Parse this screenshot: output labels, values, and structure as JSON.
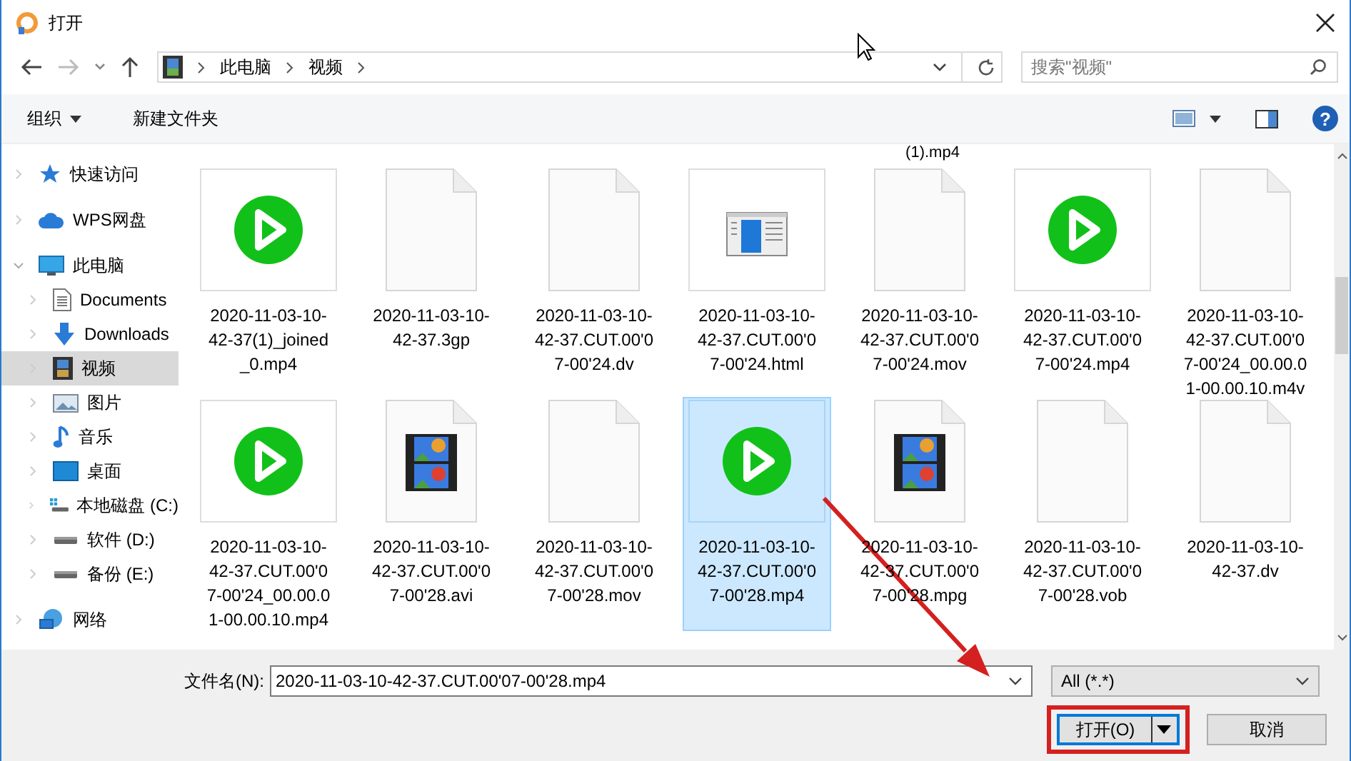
{
  "window": {
    "title": "打开"
  },
  "address_bar": {
    "forward_disabled": true,
    "breadcrumbs": [
      "此电脑",
      "视频"
    ],
    "search": {
      "placeholder": "搜索\"视频\""
    }
  },
  "toolbar": {
    "organize": "组织",
    "new_folder": "新建文件夹",
    "help": "?"
  },
  "sidebar": {
    "items": [
      {
        "label": "快速访问",
        "kind": "star",
        "selected": false,
        "expanded": false
      },
      {
        "label": "WPS网盘",
        "kind": "cloud",
        "selected": false,
        "expanded": false
      },
      {
        "label": "此电脑",
        "kind": "pc",
        "selected": false,
        "expanded": true,
        "children": [
          {
            "label": "Documents",
            "kind": "doc",
            "selected": false
          },
          {
            "label": "Downloads",
            "kind": "download",
            "selected": false
          },
          {
            "label": "视频",
            "kind": "video",
            "selected": true
          },
          {
            "label": "图片",
            "kind": "picture",
            "selected": false
          },
          {
            "label": "音乐",
            "kind": "music",
            "selected": false
          },
          {
            "label": "桌面",
            "kind": "desktop",
            "selected": false
          },
          {
            "label": "本地磁盘 (C:)",
            "kind": "system-drive",
            "selected": false
          },
          {
            "label": "软件 (D:)",
            "kind": "drive",
            "selected": false
          },
          {
            "label": "备份 (E:)",
            "kind": "drive",
            "selected": false
          }
        ]
      },
      {
        "label": "网络",
        "kind": "network",
        "selected": false,
        "expanded": false
      }
    ]
  },
  "files": {
    "partial_above": "(1).mp4",
    "rows": [
      [
        {
          "lines": [
            "2020-11-03-10-",
            "42-37(1)_joined",
            "_0.mp4"
          ],
          "kind": "player",
          "selected": false
        },
        {
          "lines": [
            "2020-11-03-10-",
            "42-37.3gp"
          ],
          "kind": "blank",
          "selected": false
        },
        {
          "lines": [
            "2020-11-03-10-",
            "42-37.CUT.00'0",
            "7-00'24.dv"
          ],
          "kind": "blank",
          "selected": false
        },
        {
          "lines": [
            "2020-11-03-10-",
            "42-37.CUT.00'0",
            "7-00'24.html"
          ],
          "kind": "webpage",
          "selected": false
        },
        {
          "lines": [
            "2020-11-03-10-",
            "42-37.CUT.00'0",
            "7-00'24.mov"
          ],
          "kind": "blank",
          "selected": false
        },
        {
          "lines": [
            "2020-11-03-10-",
            "42-37.CUT.00'0",
            "7-00'24.mp4"
          ],
          "kind": "player",
          "selected": false
        },
        {
          "lines": [
            "2020-11-03-10-",
            "42-37.CUT.00'0",
            "7-00'24_00.00.0",
            "1-00.00.10.m4v"
          ],
          "kind": "blank",
          "selected": false
        }
      ],
      [
        {
          "lines": [
            "2020-11-03-10-",
            "42-37.CUT.00'0",
            "7-00'24_00.00.0",
            "1-00.00.10.mp4"
          ],
          "kind": "player",
          "selected": false
        },
        {
          "lines": [
            "2020-11-03-10-",
            "42-37.CUT.00'0",
            "7-00'28.avi"
          ],
          "kind": "film",
          "selected": false
        },
        {
          "lines": [
            "2020-11-03-10-",
            "42-37.CUT.00'0",
            "7-00'28.mov"
          ],
          "kind": "blank",
          "selected": false
        },
        {
          "lines": [
            "2020-11-03-10-",
            "42-37.CUT.00'0",
            "7-00'28.mp4"
          ],
          "kind": "player",
          "selected": true
        },
        {
          "lines": [
            "2020-11-03-10-",
            "42-37.CUT.00'0",
            "7-00'28.mpg"
          ],
          "kind": "film",
          "selected": false
        },
        {
          "lines": [
            "2020-11-03-10-",
            "42-37.CUT.00'0",
            "7-00'28.vob"
          ],
          "kind": "blank",
          "selected": false
        },
        {
          "lines": [
            "2020-11-03-10-",
            "42-37.dv"
          ],
          "kind": "blank",
          "selected": false
        }
      ]
    ]
  },
  "footer": {
    "filename_label": "文件名(N):",
    "filename": "2020-11-03-10-42-37.CUT.00'07-00'28.mp4",
    "filter": "All (*.*)",
    "open": "打开(O)",
    "cancel": "取消"
  }
}
